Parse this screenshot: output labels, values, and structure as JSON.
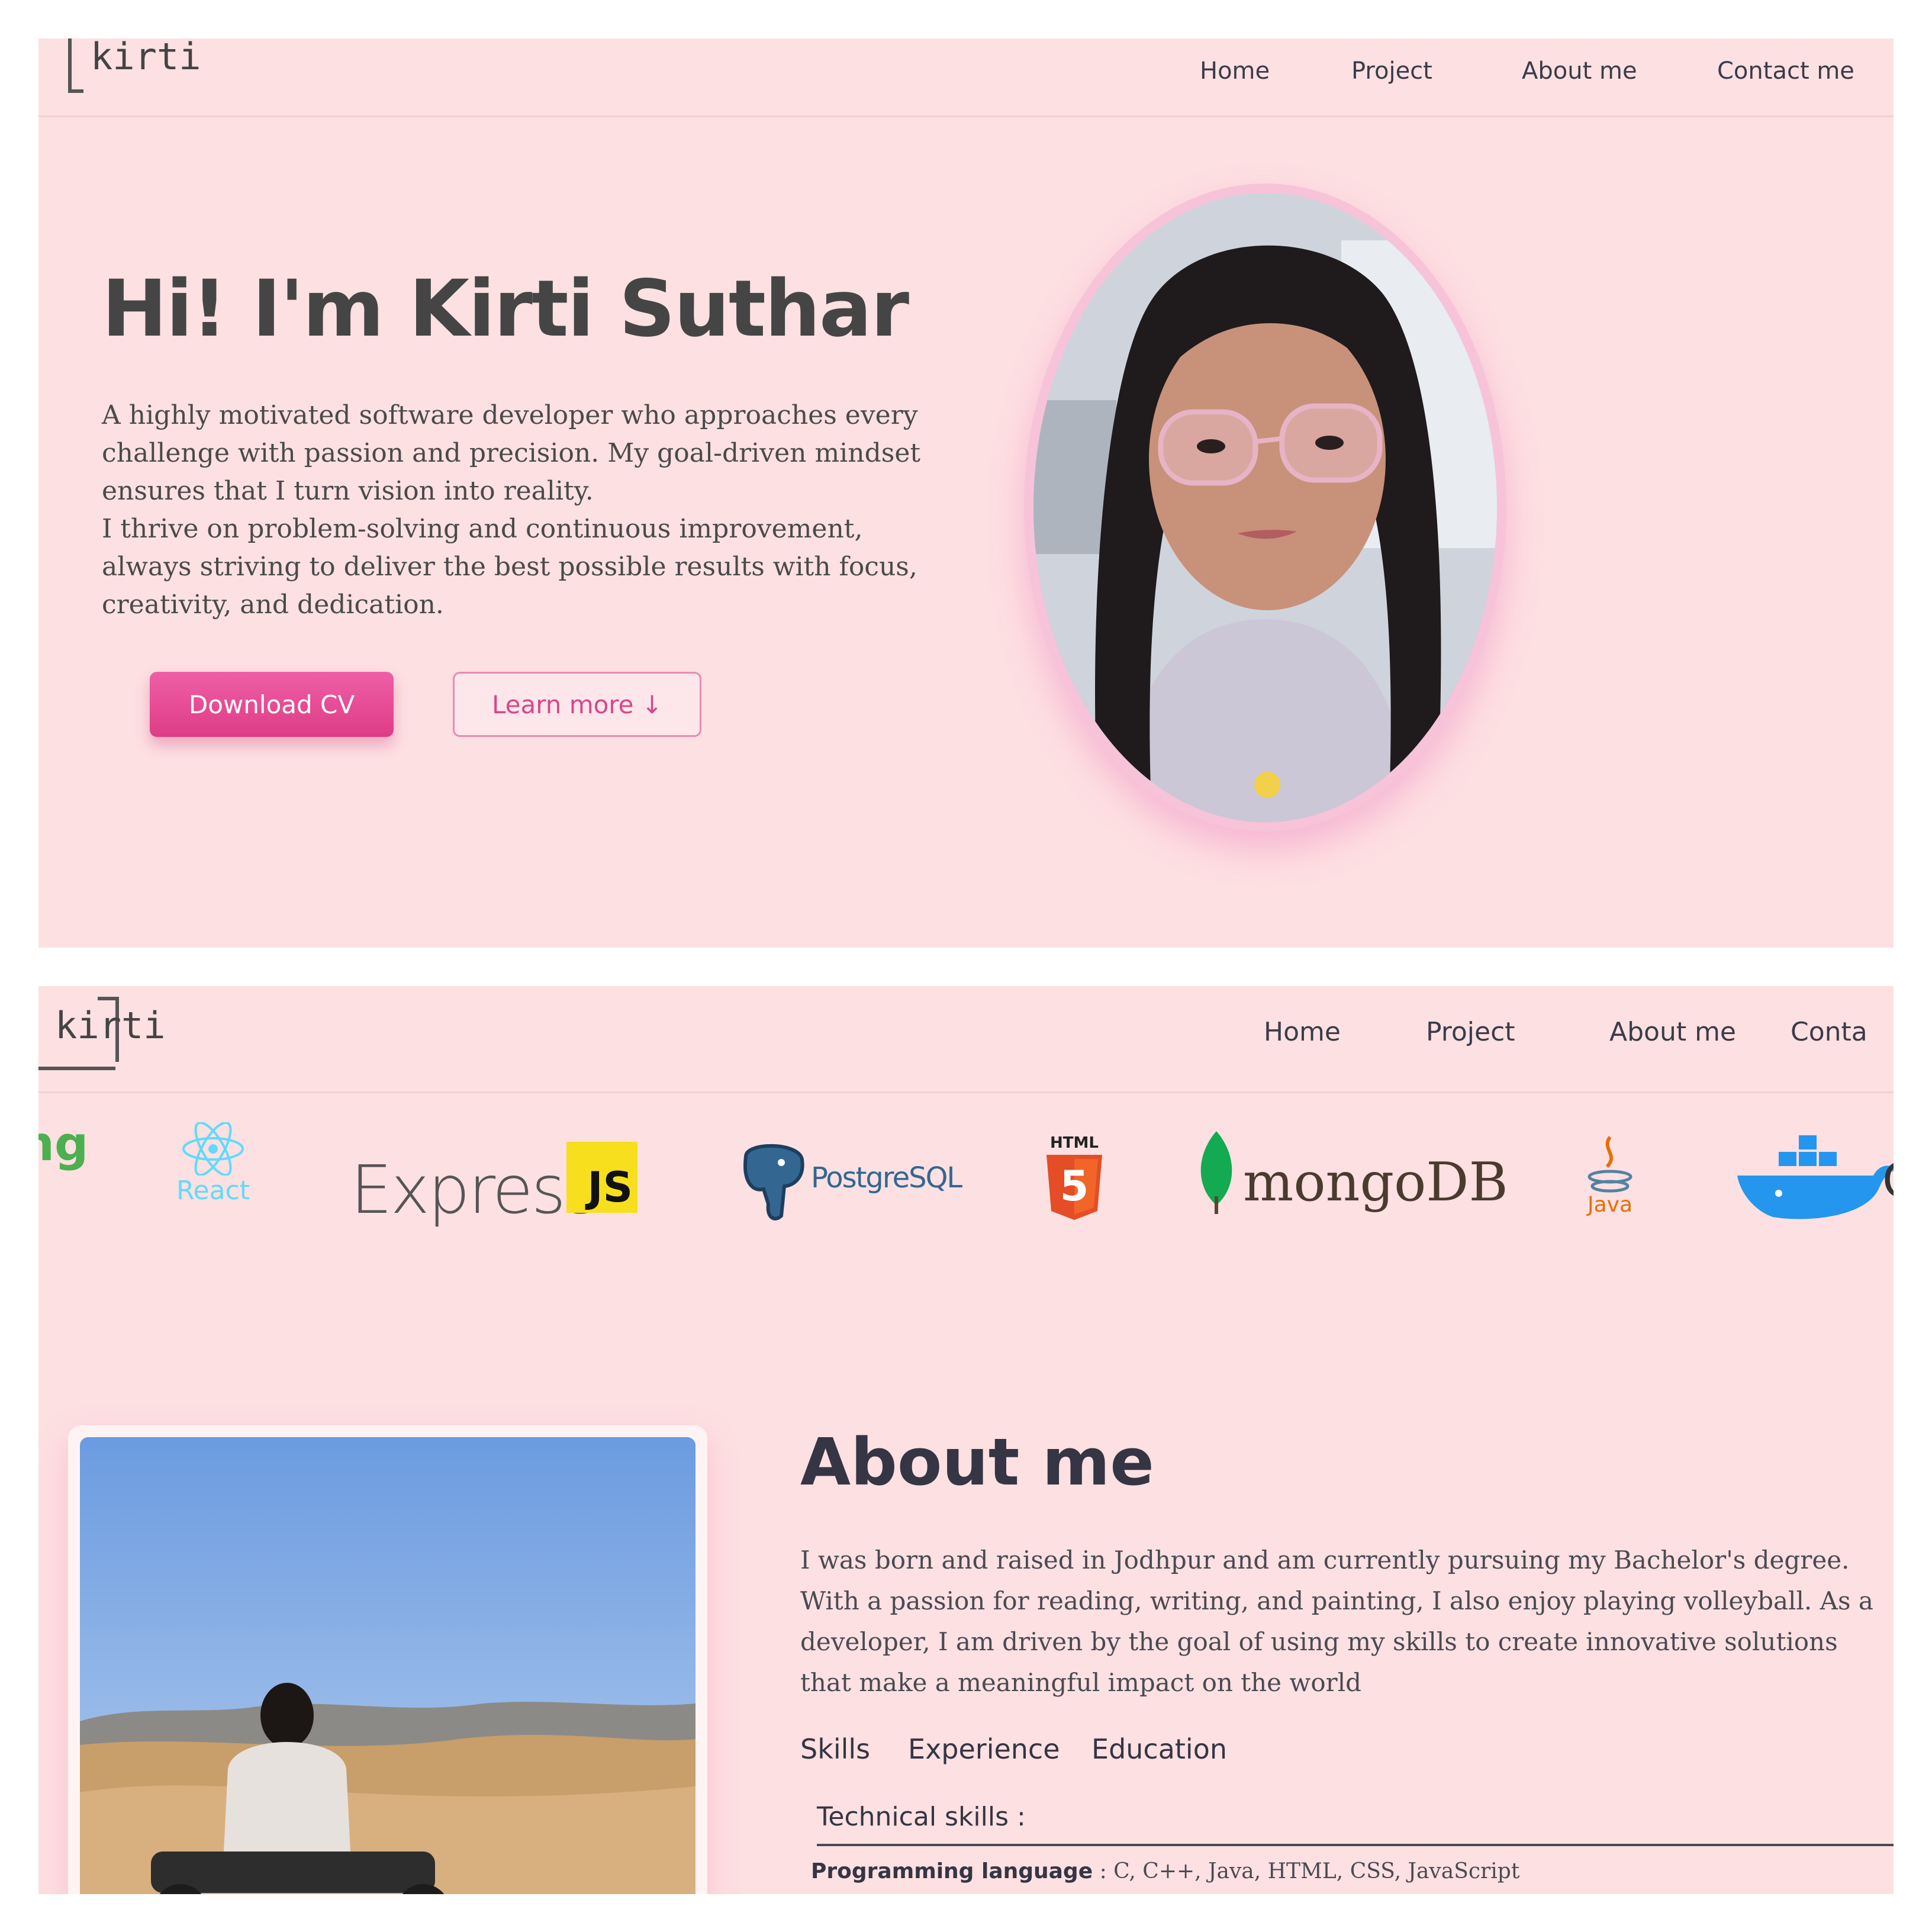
{
  "panel1": {
    "logo": "kirti",
    "nav": [
      "Home",
      "Project",
      "About me",
      "Contact me"
    ],
    "hero": {
      "title": "Hi! I'm Kirti Suthar",
      "para1": "A highly motivated software developer who approaches every challenge with passion and precision. My goal-driven mindset ensures that I turn vision into reality.",
      "para2": "I thrive on problem-solving and continuous improvement, always striving to deliver the best possible results with focus, creativity, and dedication.",
      "download_label": "Download CV",
      "learn_label": "Learn more ↓"
    }
  },
  "panel2": {
    "logo": "kirti",
    "nav": [
      "Home",
      "Project",
      "About me",
      "Conta"
    ],
    "tech": {
      "partial_left": "ng",
      "react": "React",
      "express": "Express",
      "js": "JS",
      "postgres": "PostgreSQL",
      "html": "HTML",
      "html_num": "5",
      "mongo": "mongoDB",
      "java": "Java",
      "partial_right": "C"
    },
    "about": {
      "title": "About me",
      "text": "I was born and raised in Jodhpur and am currently pursuing my Bachelor's degree. With a passion for reading, writing, and painting, I also enjoy playing volleyball. As a developer, I am driven by the goal of using my skills to create innovative solutions that make a meaningful impact on the world",
      "tabs": [
        "Skills",
        "Experience",
        "Education"
      ],
      "skills_heading": "Technical skills :",
      "skills_row_label": "Programming language",
      "skills_row_sep": " : ",
      "skills_row_value": "C, C++, Java, HTML, CSS, JavaScript"
    }
  },
  "colors": {
    "background": "#fde0e2",
    "accent": "#de3c86",
    "text": "#3d3d45"
  }
}
